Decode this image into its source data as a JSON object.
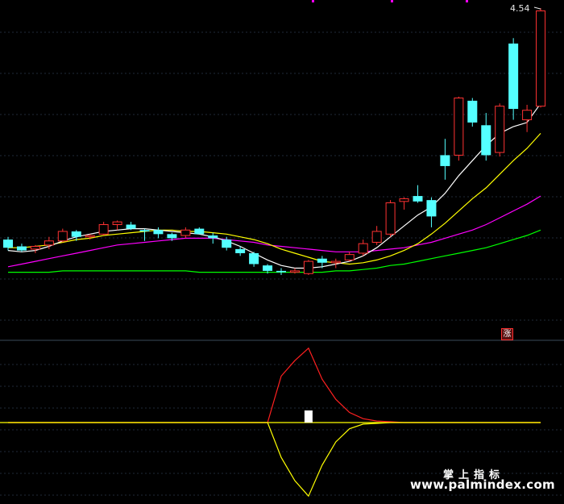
{
  "chart_data": [
    {
      "type": "candlestick",
      "title": "",
      "annotations": {
        "max_label": "4.54",
        "signal_badge": "涨"
      },
      "grid": true,
      "y_range": [
        2.1,
        4.6
      ],
      "colors": {
        "up": "#ff3232",
        "down": "#54ffff",
        "ma5": "#ffffff",
        "ma10": "#ffff00",
        "ma20": "#ff00ff",
        "ma60": "#00ff00",
        "background": "#000000",
        "grid": "#1f2a38"
      },
      "candles": [
        {
          "o": 2.84,
          "h": 2.86,
          "l": 2.76,
          "c": 2.78
        },
        {
          "o": 2.79,
          "h": 2.81,
          "l": 2.75,
          "c": 2.76
        },
        {
          "o": 2.77,
          "h": 2.8,
          "l": 2.74,
          "c": 2.79
        },
        {
          "o": 2.8,
          "h": 2.86,
          "l": 2.77,
          "c": 2.83
        },
        {
          "o": 2.83,
          "h": 2.92,
          "l": 2.82,
          "c": 2.9
        },
        {
          "o": 2.9,
          "h": 2.91,
          "l": 2.83,
          "c": 2.86
        },
        {
          "o": 2.86,
          "h": 2.88,
          "l": 2.84,
          "c": 2.87
        },
        {
          "o": 2.88,
          "h": 2.97,
          "l": 2.87,
          "c": 2.95
        },
        {
          "o": 2.95,
          "h": 2.98,
          "l": 2.91,
          "c": 2.97
        },
        {
          "o": 2.95,
          "h": 2.97,
          "l": 2.91,
          "c": 2.92
        },
        {
          "o": 2.91,
          "h": 2.92,
          "l": 2.83,
          "c": 2.9
        },
        {
          "o": 2.91,
          "h": 2.93,
          "l": 2.85,
          "c": 2.88
        },
        {
          "o": 2.88,
          "h": 2.89,
          "l": 2.83,
          "c": 2.85
        },
        {
          "o": 2.87,
          "h": 2.93,
          "l": 2.85,
          "c": 2.91
        },
        {
          "o": 2.92,
          "h": 2.93,
          "l": 2.88,
          "c": 2.88
        },
        {
          "o": 2.87,
          "h": 2.89,
          "l": 2.81,
          "c": 2.85
        },
        {
          "o": 2.84,
          "h": 2.86,
          "l": 2.76,
          "c": 2.78
        },
        {
          "o": 2.77,
          "h": 2.79,
          "l": 2.72,
          "c": 2.74
        },
        {
          "o": 2.74,
          "h": 2.75,
          "l": 2.64,
          "c": 2.66
        },
        {
          "o": 2.65,
          "h": 2.66,
          "l": 2.59,
          "c": 2.61
        },
        {
          "o": 2.61,
          "h": 2.63,
          "l": 2.58,
          "c": 2.6
        },
        {
          "o": 2.6,
          "h": 2.63,
          "l": 2.59,
          "c": 2.61
        },
        {
          "o": 2.59,
          "h": 2.69,
          "l": 2.58,
          "c": 2.68
        },
        {
          "o": 2.7,
          "h": 2.72,
          "l": 2.63,
          "c": 2.67
        },
        {
          "o": 2.67,
          "h": 2.7,
          "l": 2.63,
          "c": 2.68
        },
        {
          "o": 2.69,
          "h": 2.75,
          "l": 2.68,
          "c": 2.73
        },
        {
          "o": 2.74,
          "h": 2.84,
          "l": 2.72,
          "c": 2.81
        },
        {
          "o": 2.82,
          "h": 2.94,
          "l": 2.8,
          "c": 2.9
        },
        {
          "o": 2.88,
          "h": 3.13,
          "l": 2.86,
          "c": 3.11
        },
        {
          "o": 3.12,
          "h": 3.15,
          "l": 3.06,
          "c": 3.14
        },
        {
          "o": 3.16,
          "h": 3.24,
          "l": 3.11,
          "c": 3.12
        },
        {
          "o": 3.13,
          "h": 3.15,
          "l": 2.93,
          "c": 3.01
        },
        {
          "o": 3.46,
          "h": 3.58,
          "l": 3.28,
          "c": 3.38
        },
        {
          "o": 3.46,
          "h": 3.89,
          "l": 3.42,
          "c": 3.88
        },
        {
          "o": 3.86,
          "h": 3.88,
          "l": 3.67,
          "c": 3.7
        },
        {
          "o": 3.68,
          "h": 3.77,
          "l": 3.42,
          "c": 3.46
        },
        {
          "o": 3.48,
          "h": 3.84,
          "l": 3.45,
          "c": 3.82
        },
        {
          "o": 4.28,
          "h": 4.32,
          "l": 3.72,
          "c": 3.8
        },
        {
          "o": 3.72,
          "h": 3.83,
          "l": 3.63,
          "c": 3.79
        },
        {
          "o": 3.82,
          "h": 4.54,
          "l": 3.81,
          "c": 4.52
        }
      ],
      "ma5": [
        2.76,
        2.75,
        2.76,
        2.79,
        2.83,
        2.86,
        2.88,
        2.9,
        2.91,
        2.92,
        2.92,
        2.91,
        2.9,
        2.89,
        2.88,
        2.86,
        2.83,
        2.79,
        2.74,
        2.69,
        2.65,
        2.63,
        2.63,
        2.64,
        2.66,
        2.68,
        2.72,
        2.78,
        2.86,
        2.94,
        3.02,
        3.08,
        3.18,
        3.31,
        3.42,
        3.53,
        3.62,
        3.67,
        3.7,
        3.84
      ],
      "ma10": [
        2.78,
        2.78,
        2.79,
        2.8,
        2.82,
        2.84,
        2.85,
        2.87,
        2.88,
        2.89,
        2.9,
        2.91,
        2.91,
        2.9,
        2.9,
        2.89,
        2.88,
        2.86,
        2.84,
        2.81,
        2.77,
        2.74,
        2.71,
        2.68,
        2.67,
        2.66,
        2.67,
        2.69,
        2.72,
        2.76,
        2.81,
        2.88,
        2.96,
        3.05,
        3.14,
        3.22,
        3.32,
        3.42,
        3.51,
        3.62
      ],
      "ma20": [
        2.64,
        2.66,
        2.68,
        2.7,
        2.72,
        2.74,
        2.76,
        2.78,
        2.8,
        2.81,
        2.82,
        2.83,
        2.84,
        2.85,
        2.85,
        2.85,
        2.84,
        2.83,
        2.82,
        2.8,
        2.79,
        2.78,
        2.77,
        2.76,
        2.75,
        2.75,
        2.75,
        2.76,
        2.77,
        2.78,
        2.8,
        2.82,
        2.85,
        2.88,
        2.91,
        2.95,
        3.0,
        3.05,
        3.1,
        3.16
      ],
      "ma60": [
        2.6,
        2.6,
        2.6,
        2.6,
        2.61,
        2.61,
        2.61,
        2.61,
        2.61,
        2.61,
        2.61,
        2.61,
        2.61,
        2.61,
        2.6,
        2.6,
        2.6,
        2.6,
        2.6,
        2.6,
        2.6,
        2.6,
        2.6,
        2.6,
        2.61,
        2.61,
        2.62,
        2.63,
        2.65,
        2.66,
        2.68,
        2.7,
        2.72,
        2.74,
        2.76,
        2.78,
        2.81,
        2.84,
        2.87,
        2.91
      ]
    },
    {
      "type": "line",
      "title": "",
      "y_range": [
        -1,
        1
      ],
      "colors": {
        "upper": "#ff2020",
        "lower": "#ffff00",
        "marker": "#ffffff"
      },
      "baseline": 0,
      "upper": [
        [
          0,
          0
        ],
        [
          19,
          0
        ],
        [
          20,
          0.6
        ],
        [
          21,
          0.8
        ],
        [
          22,
          0.96
        ],
        [
          23,
          0.56
        ],
        [
          24,
          0.3
        ],
        [
          25,
          0.13
        ],
        [
          26,
          0.05
        ],
        [
          27,
          0.02
        ],
        [
          28,
          0.01
        ],
        [
          29,
          0.0
        ],
        [
          30,
          0.0
        ],
        [
          39,
          0.0
        ]
      ],
      "lower": [
        [
          0,
          0
        ],
        [
          19,
          0
        ],
        [
          20,
          -0.45
        ],
        [
          21,
          -0.75
        ],
        [
          22,
          -0.95
        ],
        [
          23,
          -0.55
        ],
        [
          24,
          -0.25
        ],
        [
          25,
          -0.08
        ],
        [
          26,
          -0.02
        ],
        [
          27,
          -0.01
        ],
        [
          28,
          0.0
        ],
        [
          39,
          0.0
        ]
      ],
      "marker_at": 22
    }
  ],
  "watermark": {
    "line1": "掌上指标",
    "line2": "www.palmindex.com"
  }
}
